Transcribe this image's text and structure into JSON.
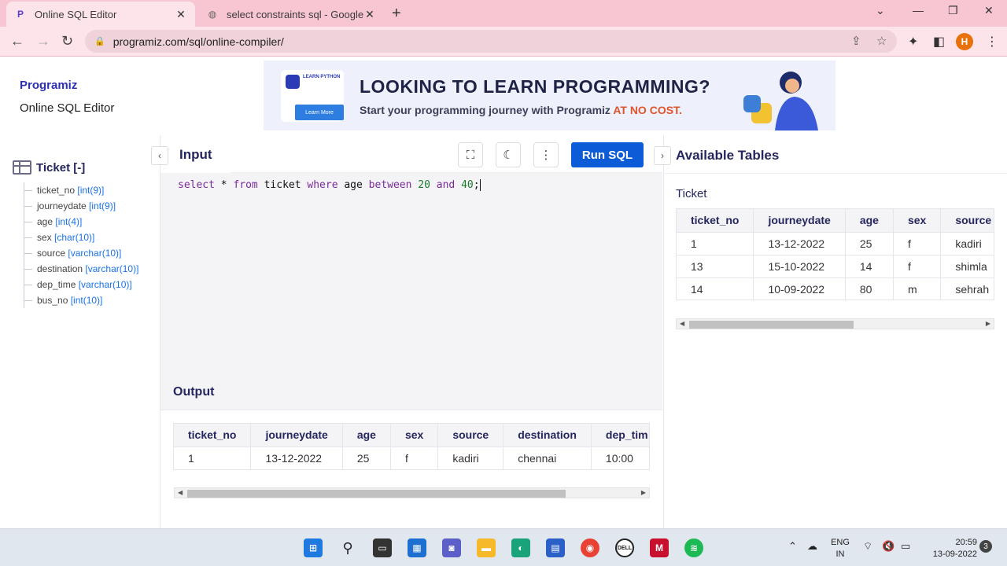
{
  "browser": {
    "tabs": [
      {
        "title": "Online SQL Editor",
        "active": true
      },
      {
        "title": "select constraints sql - Google Se",
        "active": false
      }
    ],
    "url": "programiz.com/sql/online-compiler/",
    "profile_initial": "H"
  },
  "header": {
    "logo": "Programiz",
    "subtitle": "Online SQL Editor"
  },
  "ad": {
    "badge": "LEARN PYTHON",
    "badge_button": "Learn More",
    "headline": "LOOKING TO LEARN PROGRAMMING?",
    "subline_prefix": "Start your programming journey with Programiz ",
    "subline_highlight": "AT NO COST."
  },
  "schema": {
    "table_label": "Ticket [-]",
    "columns": [
      {
        "name": "ticket_no",
        "type": "[int(9)]"
      },
      {
        "name": "journeydate",
        "type": "[int(9)]"
      },
      {
        "name": "age",
        "type": "[int(4)]"
      },
      {
        "name": "sex",
        "type": "[char(10)]"
      },
      {
        "name": "source",
        "type": "[varchar(10)]"
      },
      {
        "name": "destination",
        "type": "[varchar(10)]"
      },
      {
        "name": "dep_time",
        "type": "[varchar(10)]"
      },
      {
        "name": "bus_no",
        "type": "[int(10)]"
      }
    ]
  },
  "editor": {
    "tab_label": "Input",
    "run_label": "Run SQL",
    "code_tokens": [
      {
        "t": "select",
        "c": "kw"
      },
      {
        "t": " * ",
        "c": ""
      },
      {
        "t": "from",
        "c": "kw"
      },
      {
        "t": " ticket ",
        "c": ""
      },
      {
        "t": "where",
        "c": "kw"
      },
      {
        "t": " age ",
        "c": ""
      },
      {
        "t": "between",
        "c": "kw"
      },
      {
        "t": " ",
        "c": ""
      },
      {
        "t": "20",
        "c": "num"
      },
      {
        "t": " ",
        "c": ""
      },
      {
        "t": "and",
        "c": "kw"
      },
      {
        "t": " ",
        "c": ""
      },
      {
        "t": "40",
        "c": "num"
      },
      {
        "t": ";",
        "c": ""
      }
    ]
  },
  "output": {
    "title": "Output",
    "headers": [
      "ticket_no",
      "journeydate",
      "age",
      "sex",
      "source",
      "destination",
      "dep_tim"
    ],
    "rows": [
      [
        "1",
        "13-12-2022",
        "25",
        "f",
        "kadiri",
        "chennai",
        "10:00"
      ]
    ]
  },
  "available": {
    "title": "Available Tables",
    "table_name": "Ticket",
    "headers": [
      "ticket_no",
      "journeydate",
      "age",
      "sex",
      "source"
    ],
    "rows": [
      [
        "1",
        "13-12-2022",
        "25",
        "f",
        "kadiri"
      ],
      [
        "13",
        "15-10-2022",
        "14",
        "f",
        "shimla"
      ],
      [
        "14",
        "10-09-2022",
        "80",
        "m",
        "sehrah"
      ]
    ]
  },
  "taskbar": {
    "lang_top": "ENG",
    "lang_bottom": "IN",
    "time": "20:59",
    "date": "13-09-2022",
    "notifications": "3"
  }
}
